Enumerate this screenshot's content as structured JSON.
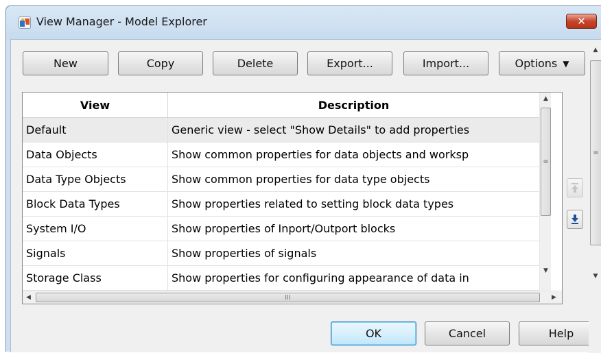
{
  "window": {
    "title": "View Manager - Model Explorer",
    "close_label": "✕",
    "icon": "simulink-app-icon"
  },
  "toolbar": {
    "new_label": "New",
    "copy_label": "Copy",
    "delete_label": "Delete",
    "export_label": "Export...",
    "import_label": "Import...",
    "options_label": "Options",
    "options_caret": "▼"
  },
  "table": {
    "columns": [
      "View",
      "Description"
    ],
    "rows": [
      {
        "view": "Default",
        "description": "Generic view - select \"Show Details\" to add properties"
      },
      {
        "view": "Data Objects",
        "description": "Show common properties for data objects and worksp"
      },
      {
        "view": "Data Type Objects",
        "description": "Show common properties for data type objects"
      },
      {
        "view": "Block Data Types",
        "description": "Show properties related to setting block data types"
      },
      {
        "view": "System I/O",
        "description": "Show properties of Inport/Outport blocks"
      },
      {
        "view": "Signals",
        "description": "Show properties of signals"
      },
      {
        "view": "Storage Class",
        "description": "Show properties for configuring appearance of data in"
      }
    ],
    "selected_row": "Default",
    "hscroll_grip": "III",
    "vscroll_grip": "≡"
  },
  "footer": {
    "ok_label": "OK",
    "cancel_label": "Cancel",
    "help_label": "Help"
  },
  "colors": {
    "titlebar": "#c7dbef",
    "close_button": "#c8442c",
    "client_bg": "#f0f0f0",
    "selected_row": "#ebebeb",
    "move_down_arrow": "#1f4e9a"
  }
}
